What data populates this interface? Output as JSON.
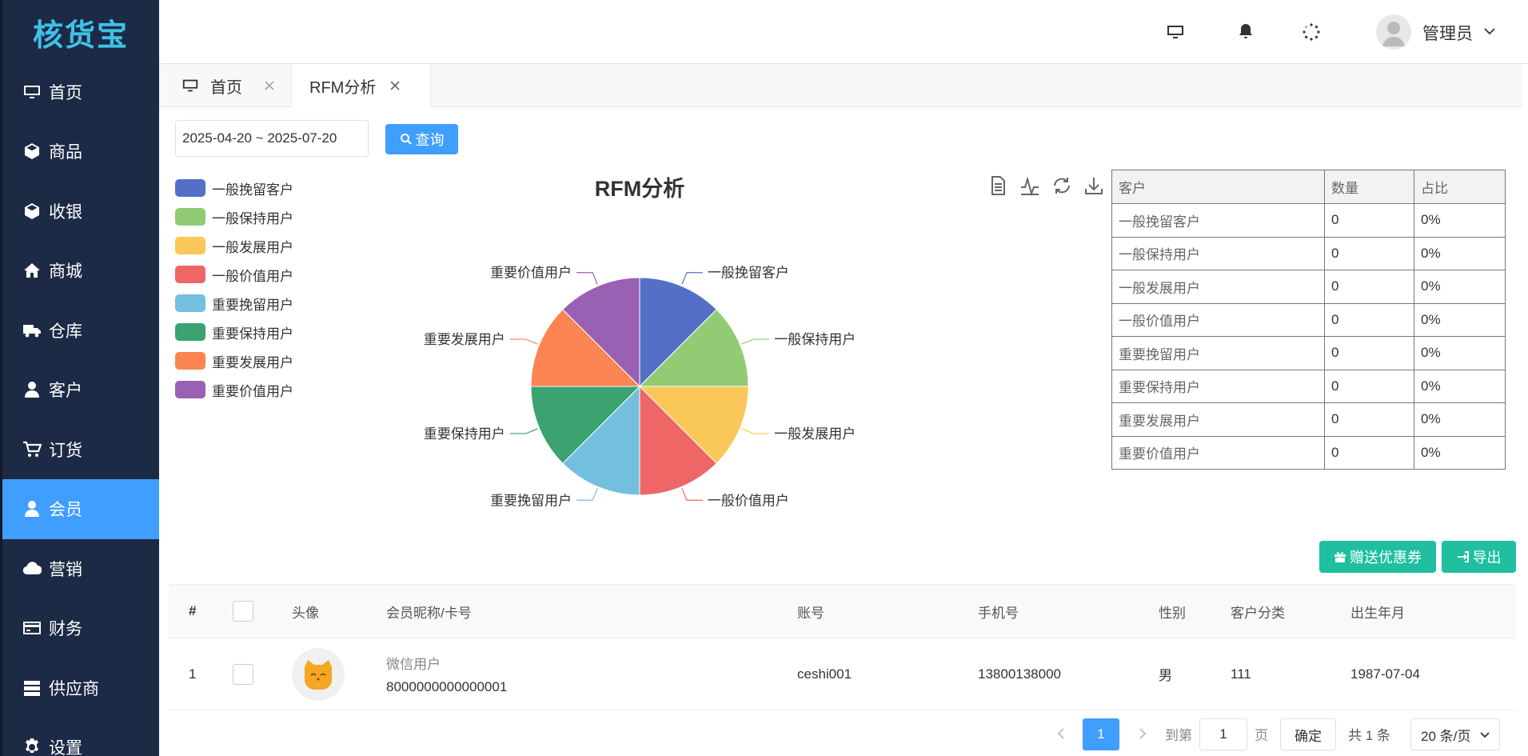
{
  "app": {
    "logo": "核货宝"
  },
  "sidebar": {
    "items": [
      {
        "label": "首页",
        "icon": "monitor-icon",
        "active": false
      },
      {
        "label": "商品",
        "icon": "cube-icon",
        "active": false
      },
      {
        "label": "收银",
        "icon": "cube-icon",
        "active": false
      },
      {
        "label": "商城",
        "icon": "home-icon",
        "active": false
      },
      {
        "label": "仓库",
        "icon": "truck-icon",
        "active": false
      },
      {
        "label": "客户",
        "icon": "user-icon",
        "active": false
      },
      {
        "label": "订货",
        "icon": "cart-icon",
        "active": false
      },
      {
        "label": "会员",
        "icon": "user-icon",
        "active": true
      },
      {
        "label": "营销",
        "icon": "cloud-icon",
        "active": false
      },
      {
        "label": "财务",
        "icon": "credit-card-icon",
        "active": false
      },
      {
        "label": "供应商",
        "icon": "server-icon",
        "active": false
      },
      {
        "label": "设置",
        "icon": "gear-icon",
        "active": false
      }
    ]
  },
  "header": {
    "user_name": "管理员"
  },
  "tabs": [
    {
      "label": "首页",
      "active": false
    },
    {
      "label": "RFM分析",
      "active": true
    }
  ],
  "filter": {
    "date_range": "2025-04-20 ~ 2025-07-20",
    "query_label": "查询"
  },
  "chart_data": {
    "type": "pie",
    "title": "RFM分析",
    "categories": [
      "一般挽留客户",
      "一般保持用户",
      "一般发展用户",
      "一般价值用户",
      "重要挽留用户",
      "重要保持用户",
      "重要发展用户",
      "重要价值用户"
    ],
    "values": [
      0,
      0,
      0,
      0,
      0,
      0,
      0,
      0
    ],
    "colors": [
      "#5470c6",
      "#91cc75",
      "#fac858",
      "#ee6666",
      "#73c0de",
      "#3ba272",
      "#fc8452",
      "#9a60b4"
    ],
    "legend": "left"
  },
  "rfm_table": {
    "headers": [
      "客户",
      "数量",
      "占比"
    ],
    "rows": [
      [
        "一般挽留客户",
        "0",
        "0%"
      ],
      [
        "一般保持用户",
        "0",
        "0%"
      ],
      [
        "一般发展用户",
        "0",
        "0%"
      ],
      [
        "一般价值用户",
        "0",
        "0%"
      ],
      [
        "重要挽留用户",
        "0",
        "0%"
      ],
      [
        "重要保持用户",
        "0",
        "0%"
      ],
      [
        "重要发展用户",
        "0",
        "0%"
      ],
      [
        "重要价值用户",
        "0",
        "0%"
      ]
    ]
  },
  "actions": {
    "coupon_label": "赠送优惠券",
    "export_label": "导出"
  },
  "member_table": {
    "headers": [
      "#",
      "",
      "头像",
      "会员昵称/卡号",
      "账号",
      "手机号",
      "性别",
      "客户分类",
      "出生年月"
    ],
    "rows": [
      {
        "index": "1",
        "nickname": "微信用户",
        "card_no": "8000000000000001",
        "account": "ceshi001",
        "phone": "13800138000",
        "gender": "男",
        "category": "111",
        "birth": "1987-07-04"
      }
    ]
  },
  "pager": {
    "current_page": "1",
    "goto_prefix": "到第",
    "goto_value": "1",
    "goto_suffix": "页",
    "confirm_label": "确定",
    "total_text": "共 1 条",
    "page_size": "20 条/页"
  }
}
